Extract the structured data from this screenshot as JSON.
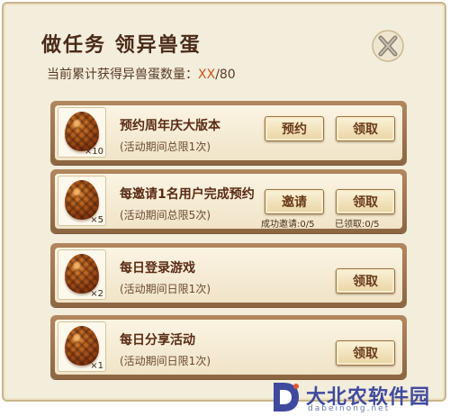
{
  "title": "做任务 领异兽蛋",
  "progress": {
    "label": "当前累计获得异兽蛋数量：",
    "current": "XX",
    "total": "/80"
  },
  "close_icon": "close-x-icon",
  "tasks": [
    {
      "name": "预约周年庆大版本",
      "limit": "(活动期间总限1次)",
      "qty": "×10",
      "action": "预约",
      "claim": "领取"
    },
    {
      "name": "每邀请1名用户完成预约",
      "limit": "(活动期间总限5次)",
      "qty": "×5",
      "action": "邀请",
      "claim": "领取",
      "action_note": "成功邀请:0/5",
      "claim_note": "已领取:0/5"
    },
    {
      "name": "每日登录游戏",
      "limit": "(活动期间日限1次)",
      "qty": "×2",
      "claim": "领取"
    },
    {
      "name": "每日分享活动",
      "limit": "(活动期间日限1次)",
      "qty": "×1",
      "claim": "领取"
    }
  ],
  "watermark": {
    "name": "大北农软件园",
    "url": "dabeinong.net"
  },
  "colors": {
    "panel": "#f3eddc",
    "title": "#4a2a18",
    "accent": "#c8571c",
    "frame": "#a37a50"
  }
}
